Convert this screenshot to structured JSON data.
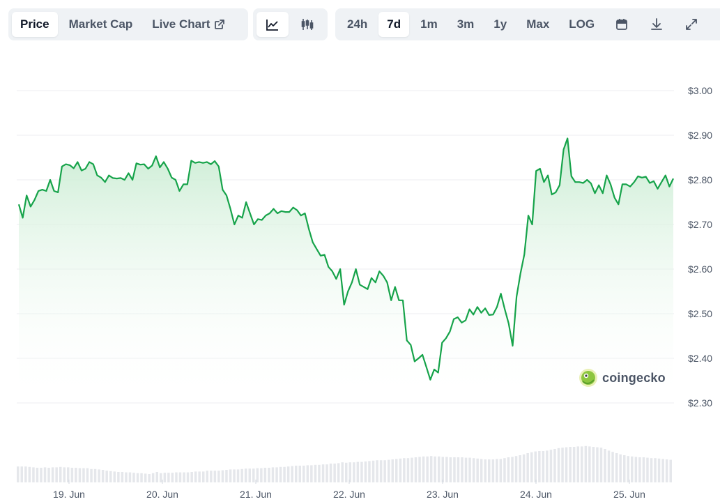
{
  "toolbar": {
    "view_tabs": [
      {
        "label": "Price",
        "active": true
      },
      {
        "label": "Market Cap",
        "active": false
      },
      {
        "label": "Live Chart",
        "active": false,
        "icon": "external-link-icon"
      }
    ],
    "chart_type": [
      {
        "icon": "line-chart-icon",
        "active": true
      },
      {
        "icon": "candlestick-icon",
        "active": false
      }
    ],
    "ranges": [
      {
        "label": "24h",
        "active": false
      },
      {
        "label": "7d",
        "active": true
      },
      {
        "label": "1m",
        "active": false
      },
      {
        "label": "3m",
        "active": false
      },
      {
        "label": "1y",
        "active": false
      },
      {
        "label": "Max",
        "active": false
      },
      {
        "label": "LOG",
        "active": false
      }
    ],
    "tools": [
      "calendar-icon",
      "download-icon",
      "expand-icon"
    ]
  },
  "watermark": "coingecko",
  "colors": {
    "line": "#16a34a",
    "fill_top": "#c9ecd2",
    "grid": "#eceef1",
    "volume": "#e5e7eb"
  },
  "chart_data": {
    "type": "area",
    "x_ticks": [
      "19. Jun",
      "20. Jun",
      "21. Jun",
      "22. Jun",
      "23. Jun",
      "24. Jun",
      "25. Jun"
    ],
    "y_ticks": [
      "$3.00",
      "$2.90",
      "$2.80",
      "$2.70",
      "$2.60",
      "$2.50",
      "$2.40",
      "$2.30"
    ],
    "ylim": [
      2.3,
      3.0
    ],
    "grid": true,
    "series": [
      {
        "values": [
          2.745,
          2.715,
          2.765,
          2.74,
          2.755,
          2.775,
          2.778,
          2.775,
          2.8,
          2.775,
          2.772,
          2.83,
          2.835,
          2.833,
          2.826,
          2.84,
          2.821,
          2.825,
          2.84,
          2.835,
          2.81,
          2.805,
          2.795,
          2.81,
          2.804,
          2.803,
          2.804,
          2.8,
          2.815,
          2.8,
          2.837,
          2.834,
          2.835,
          2.825,
          2.832,
          2.853,
          2.828,
          2.84,
          2.825,
          2.805,
          2.8,
          2.775,
          2.79,
          2.79,
          2.843,
          2.838,
          2.84,
          2.838,
          2.84,
          2.835,
          2.842,
          2.83,
          2.778,
          2.765,
          2.735,
          2.7,
          2.72,
          2.715,
          2.75,
          2.725,
          2.7,
          2.712,
          2.71,
          2.72,
          2.725,
          2.735,
          2.725,
          2.73,
          2.728,
          2.728,
          2.738,
          2.732,
          2.72,
          2.725,
          2.69,
          2.66,
          2.645,
          2.63,
          2.632,
          2.605,
          2.595,
          2.578,
          2.6,
          2.52,
          2.55,
          2.57,
          2.6,
          2.565,
          2.56,
          2.555,
          2.58,
          2.57,
          2.595,
          2.585,
          2.57,
          2.53,
          2.56,
          2.53,
          2.53,
          2.44,
          2.43,
          2.393,
          2.4,
          2.408,
          2.38,
          2.352,
          2.375,
          2.368,
          2.435,
          2.445,
          2.46,
          2.488,
          2.492,
          2.48,
          2.485,
          2.51,
          2.498,
          2.515,
          2.502,
          2.512,
          2.497,
          2.498,
          2.515,
          2.545,
          2.51,
          2.478,
          2.428,
          2.538,
          2.59,
          2.633,
          2.72,
          2.7,
          2.82,
          2.825,
          2.795,
          2.81,
          2.767,
          2.772,
          2.788,
          2.868,
          2.893,
          2.808,
          2.795,
          2.795,
          2.793,
          2.8,
          2.792,
          2.77,
          2.788,
          2.77,
          2.81,
          2.79,
          2.76,
          2.745,
          2.79,
          2.79,
          2.785,
          2.795,
          2.808,
          2.805,
          2.807,
          2.793,
          2.797,
          2.78,
          2.795,
          2.81,
          2.785,
          2.803
        ]
      }
    ],
    "volume": [
      0.38,
      0.38,
      0.38,
      0.37,
      0.36,
      0.35,
      0.35,
      0.36,
      0.35,
      0.36,
      0.36,
      0.37,
      0.36,
      0.36,
      0.35,
      0.35,
      0.34,
      0.34,
      0.34,
      0.32,
      0.32,
      0.31,
      0.3,
      0.28,
      0.27,
      0.26,
      0.25,
      0.25,
      0.24,
      0.24,
      0.23,
      0.22,
      0.22,
      0.21,
      0.2,
      0.22,
      0.25,
      0.22,
      0.23,
      0.23,
      0.23,
      0.24,
      0.24,
      0.24,
      0.24,
      0.25,
      0.26,
      0.26,
      0.26,
      0.28,
      0.28,
      0.28,
      0.28,
      0.29,
      0.3,
      0.31,
      0.31,
      0.31,
      0.32,
      0.33,
      0.33,
      0.33,
      0.34,
      0.34,
      0.35,
      0.35,
      0.36,
      0.36,
      0.37,
      0.37,
      0.38,
      0.39,
      0.4,
      0.4,
      0.4,
      0.41,
      0.41,
      0.42,
      0.42,
      0.43,
      0.43,
      0.45,
      0.45,
      0.46,
      0.48,
      0.47,
      0.48,
      0.48,
      0.49,
      0.49,
      0.5,
      0.51,
      0.52,
      0.53,
      0.53,
      0.53,
      0.54,
      0.55,
      0.56,
      0.57,
      0.58,
      0.58,
      0.59,
      0.6,
      0.61,
      0.62,
      0.62,
      0.63,
      0.62,
      0.62,
      0.61,
      0.61,
      0.6,
      0.6,
      0.6,
      0.6,
      0.59,
      0.59,
      0.58,
      0.57,
      0.56,
      0.55,
      0.55,
      0.55,
      0.56,
      0.56,
      0.58,
      0.6,
      0.61,
      0.63,
      0.65,
      0.67,
      0.7,
      0.72,
      0.74,
      0.75,
      0.75,
      0.76,
      0.78,
      0.8,
      0.82,
      0.83,
      0.84,
      0.85,
      0.85,
      0.86,
      0.86,
      0.87,
      0.86,
      0.85,
      0.84,
      0.83,
      0.8,
      0.76,
      0.73,
      0.7,
      0.67,
      0.65,
      0.63,
      0.62,
      0.61,
      0.6,
      0.6,
      0.59,
      0.58,
      0.58,
      0.57,
      0.56,
      0.55,
      0.54
    ]
  }
}
